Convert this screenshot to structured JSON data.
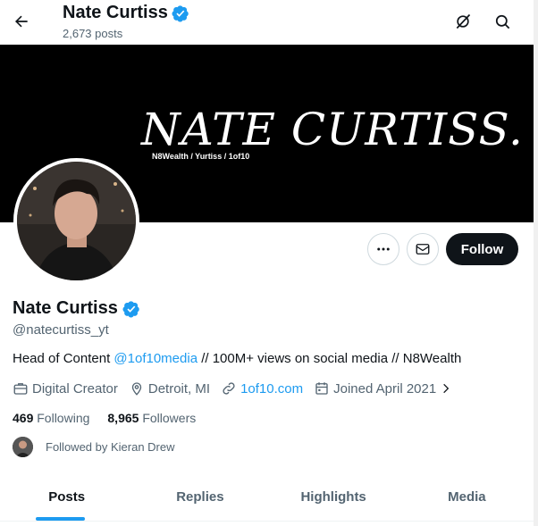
{
  "header": {
    "back_icon": "arrow-left-icon",
    "title": "Nate Curtiss",
    "post_count": "2,673 posts",
    "grok_icon": "grok-icon",
    "search_icon": "search-icon"
  },
  "banner": {
    "title": "NATE CURTISS.",
    "subtitle": "N8Wealth / Yurtiss / 1of10"
  },
  "actions": {
    "more_icon": "more-dots-icon",
    "message_icon": "envelope-icon",
    "follow_label": "Follow"
  },
  "profile": {
    "name": "Nate Curtiss",
    "handle": "@natecurtiss_yt",
    "bio_prefix": "Head of Content ",
    "bio_mention": "@1of10media",
    "bio_suffix": " // 100M+ views on social media // N8Wealth",
    "category": "Digital Creator",
    "location": "Detroit, MI",
    "website": "1of10.com",
    "joined": "Joined April 2021",
    "following_count": "469",
    "following_label": "Following",
    "followers_count": "8,965",
    "followers_label": "Followers",
    "followed_by": "Followed by Kieran Drew"
  },
  "tabs": [
    {
      "label": "Posts",
      "active": true
    },
    {
      "label": "Replies",
      "active": false
    },
    {
      "label": "Highlights",
      "active": false
    },
    {
      "label": "Media",
      "active": false
    }
  ],
  "colors": {
    "accent": "#1d9bf0",
    "text": "#0f1419",
    "secondary": "#536471",
    "follow_button": "#0f1419"
  }
}
